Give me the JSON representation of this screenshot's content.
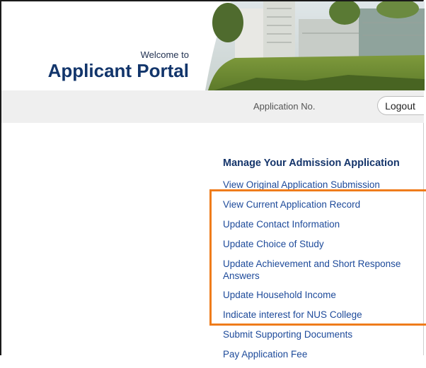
{
  "header": {
    "welcome": "Welcome to",
    "title": "Applicant Portal"
  },
  "bar": {
    "application_no_label": "Application No.",
    "logout_label": "Logout"
  },
  "menu": {
    "heading": "Manage Your Admission Application",
    "items": [
      "View Original Application Submission",
      "View Current Application Record",
      "Update Contact Information",
      "Update Choice of Study",
      "Update Achievement and Short Response Answers",
      "Update Household Income",
      "Indicate interest for NUS College",
      "Submit Supporting Documents",
      "Pay Application Fee"
    ]
  },
  "colors": {
    "title": "#12356b",
    "link": "#1d4a9a",
    "highlight": "#ef7c1b",
    "bar": "#efefef"
  }
}
